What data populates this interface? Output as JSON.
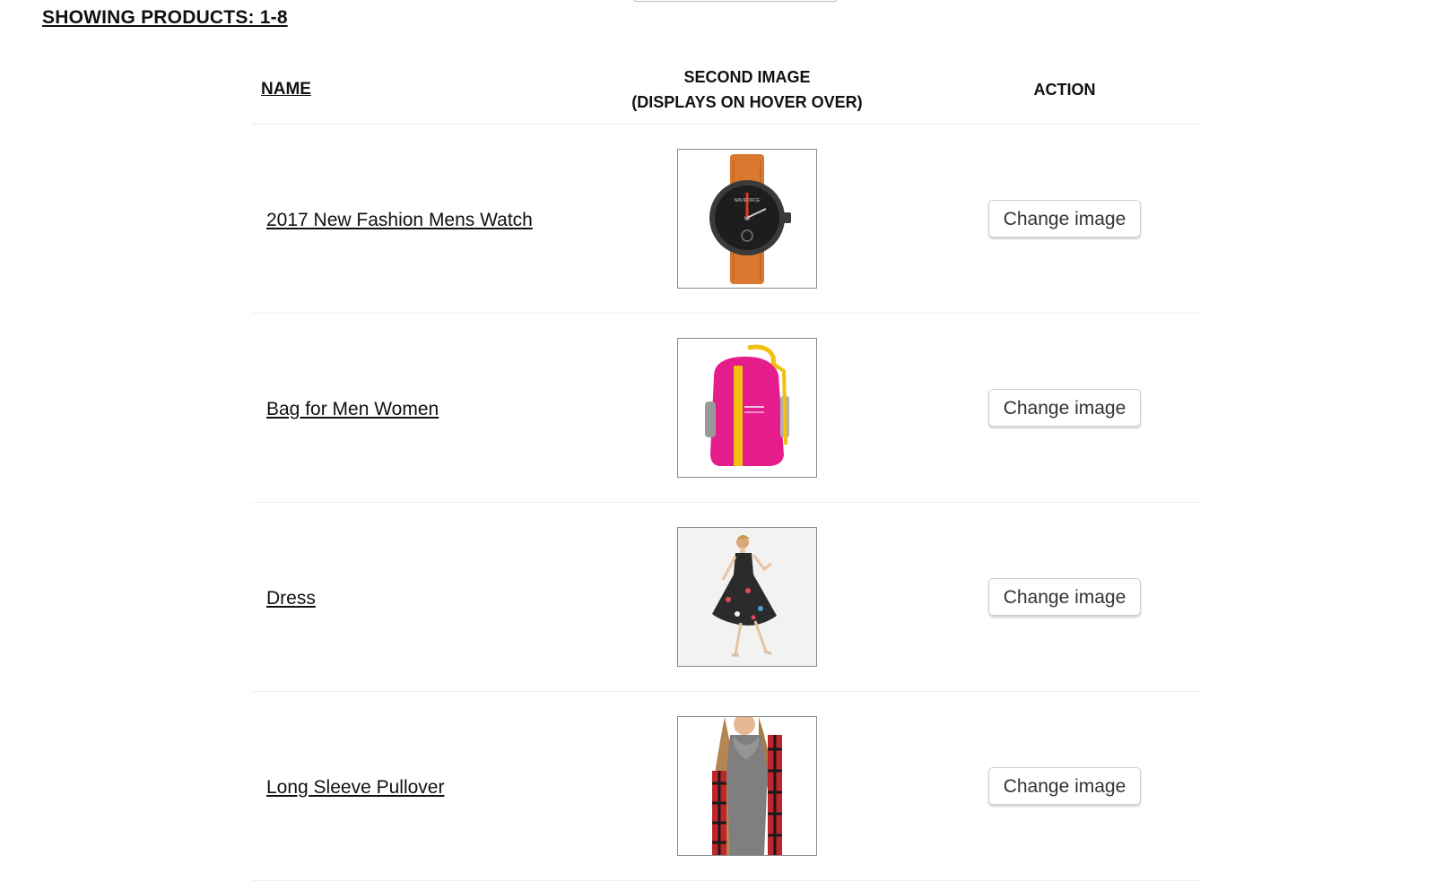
{
  "header": {
    "showing_label": "SHOWING PRODUCTS: 1-8"
  },
  "table": {
    "columns": {
      "name": "NAME",
      "image_line1": "SECOND IMAGE",
      "image_line2": "(DISPLAYS ON HOVER OVER)",
      "action": "ACTION"
    },
    "rows": [
      {
        "name": "2017 New Fashion Mens Watch",
        "image_icon": "watch-image",
        "action_label": "Change image"
      },
      {
        "name": "Bag for Men Women",
        "image_icon": "backpack-image",
        "action_label": "Change image"
      },
      {
        "name": "Dress",
        "image_icon": "dress-image",
        "action_label": "Change image"
      },
      {
        "name": "Long Sleeve Pullover",
        "image_icon": "pullover-image",
        "action_label": "Change image"
      }
    ]
  },
  "colors": {
    "watch_strap": "#d9782e",
    "backpack": "#e51c8c",
    "backpack_trim": "#f2c00f",
    "plaid": "#c0252b"
  }
}
